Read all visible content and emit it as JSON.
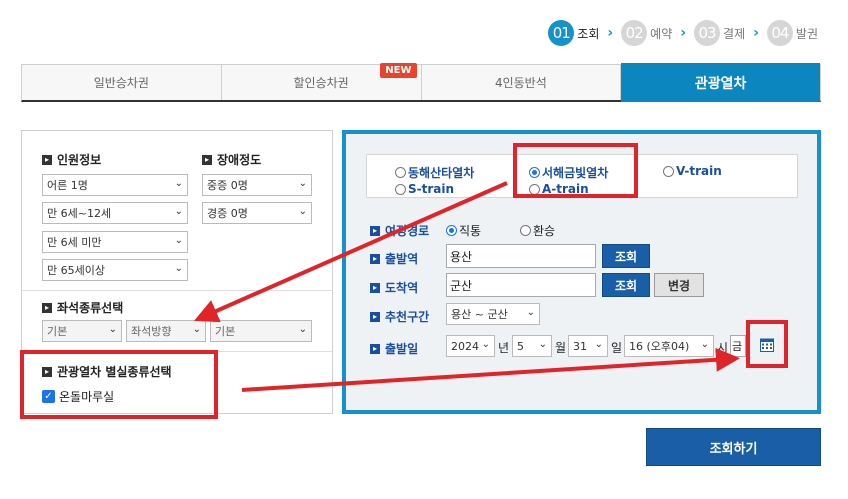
{
  "steps": [
    {
      "num": "01",
      "label": "조회",
      "active": true
    },
    {
      "num": "02",
      "label": "예약",
      "active": false
    },
    {
      "num": "03",
      "label": "결제",
      "active": false
    },
    {
      "num": "04",
      "label": "발권",
      "active": false
    }
  ],
  "tabs": {
    "general": "일반승차권",
    "discount": "할인승차권",
    "discount_badge": "NEW",
    "four_seat": "4인동반석",
    "tourist": "관광열차"
  },
  "left": {
    "passenger_title": "인원정보",
    "disability_title": "장애정도",
    "adult": "어른 1명",
    "child": "만 6세~12세",
    "infant": "만 6세 미만",
    "senior": "만 65세이상",
    "severe": "중증 0명",
    "mild": "경증 0명",
    "seat_title": "좌석종류선택",
    "seat_type": "기본",
    "seat_direction": "좌석방향",
    "seat_option": "기본",
    "room_title": "관광열차 별실종류선택",
    "room_option": "온돌마루실"
  },
  "right": {
    "trains": {
      "east": "동해산타열차",
      "west": "서해금빛열차",
      "v": "V-train",
      "s": "S-train",
      "a": "A-train"
    },
    "route_label": "여정경로",
    "direct": "직통",
    "transfer": "환승",
    "departure_label": "출발역",
    "departure_value": "용산",
    "arrival_label": "도착역",
    "arrival_value": "군산",
    "search_small": "조회",
    "change": "변경",
    "recommend_label": "추천구간",
    "recommend_value": "용산 ~ 군산",
    "date_label": "출발일",
    "year": "2024",
    "year_unit": "년",
    "month": "5",
    "month_unit": "월",
    "day": "31",
    "day_unit": "일",
    "hour": "16 (오후04)",
    "hour_unit": "시",
    "weekday": "금"
  },
  "search_button": "조회하기",
  "colors": {
    "accent": "#1591cc",
    "navy": "#1a5ea8",
    "annotation": "#e0252a"
  },
  "icons": {
    "calendar": "calendar-icon",
    "chevron": "chevron-down-icon",
    "check": "checkmark-icon"
  }
}
